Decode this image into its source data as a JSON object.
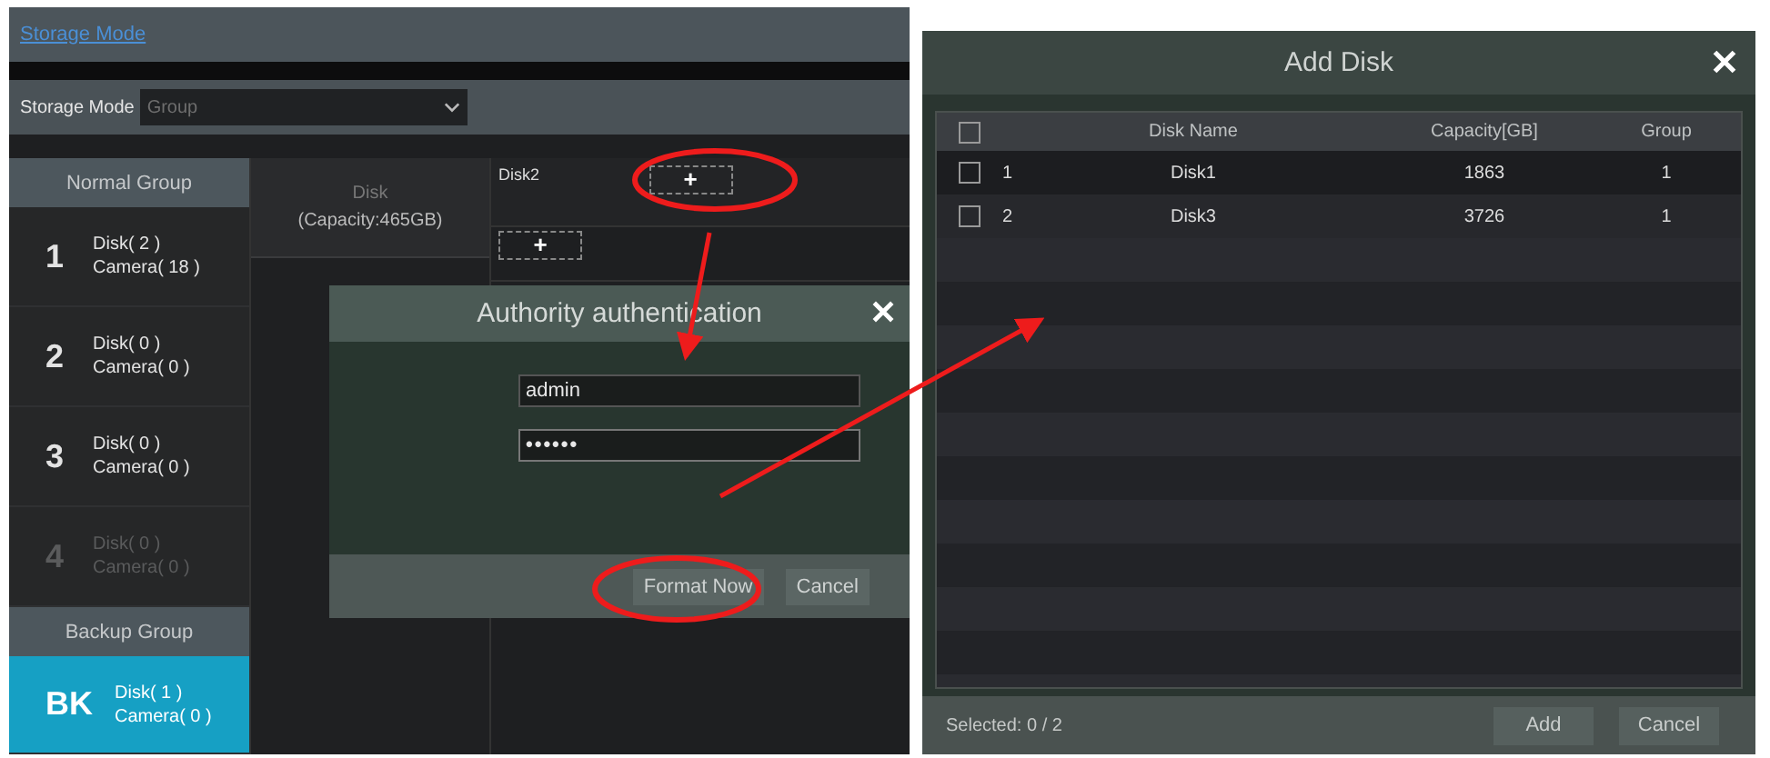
{
  "left_window": {
    "title": "Storage Mode",
    "storage_mode": {
      "label": "Storage Mode",
      "value": "Group"
    },
    "sections": [
      {
        "title": "Normal Group",
        "items": [
          {
            "number": "1",
            "disk": "Disk( 2 )",
            "camera": "Camera( 18 )",
            "selected": false,
            "disabled": false
          },
          {
            "number": "2",
            "disk": "Disk( 0 )",
            "camera": "Camera( 0 )",
            "selected": false,
            "disabled": false
          },
          {
            "number": "3",
            "disk": "Disk( 0 )",
            "camera": "Camera( 0 )",
            "selected": false,
            "disabled": false
          },
          {
            "number": "4",
            "disk": "Disk( 0 )",
            "camera": "Camera( 0 )",
            "selected": false,
            "disabled": true
          }
        ]
      },
      {
        "title": "Backup Group",
        "items": [
          {
            "number": "BK",
            "disk": "Disk( 1 )",
            "camera": "Camera( 0 )",
            "selected": true,
            "disabled": false
          }
        ]
      }
    ],
    "disk_panel": {
      "label": "Disk",
      "capacity": "(Capacity:465GB)",
      "slots": [
        {
          "name": "Disk2",
          "button": "+"
        },
        {
          "button": "+"
        }
      ]
    },
    "auth_dialog": {
      "title": "Authority authentication",
      "fields": [
        {
          "kind": "text",
          "value": "admin"
        },
        {
          "kind": "password",
          "value": "••••••"
        }
      ],
      "buttons": [
        "Format Now",
        "Cancel"
      ]
    }
  },
  "add_disk": {
    "title": "Add Disk",
    "select_all": {
      "checked": false
    },
    "columns": [
      "Disk Name",
      "Capacity[GB]",
      "Group"
    ],
    "rows": [
      {
        "checked": false,
        "index": "1",
        "name": "Disk1",
        "capacity": "1863",
        "group": "1"
      },
      {
        "checked": false,
        "index": "2",
        "name": "Disk3",
        "capacity": "3726",
        "group": "1"
      }
    ],
    "selected_count": "Selected: 0 / 2",
    "buttons": [
      "Add",
      "Cancel"
    ]
  }
}
